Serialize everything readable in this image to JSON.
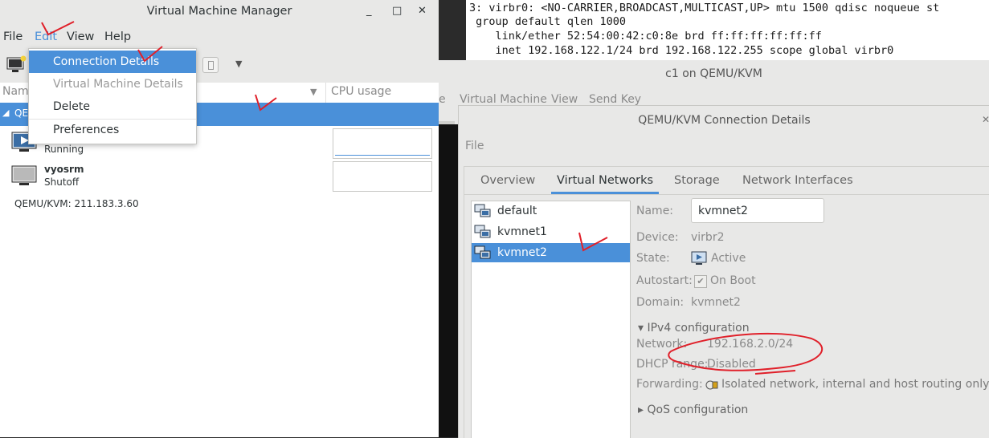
{
  "terminal": {
    "lines": [
      "3: virbr0: <NO-CARRIER,BROADCAST,MULTICAST,UP> mtu 1500 qdisc noqueue st",
      " group default qlen 1000",
      "    link/ether 52:54:00:42:c0:8e brd ff:ff:ff:ff:ff:ff",
      "    inet 192.168.122.1/24 brd 192.168.122.255 scope global virbr0"
    ]
  },
  "c1_window": {
    "title": "c1 on QEMU/KVM",
    "menu": [
      "e",
      "Virtual Machine",
      "View",
      "Send Key"
    ]
  },
  "vmm": {
    "title": "Virtual Machine Manager",
    "minimize": "_",
    "maximize": "□",
    "close": "✕",
    "menu": {
      "file": "File",
      "edit": "Edit",
      "view": "View",
      "help": "Help"
    },
    "columns": {
      "name": "Name",
      "cpu": "CPU usage"
    },
    "group": "QEMU/KVM",
    "vms": [
      {
        "name": "",
        "state": "Running",
        "icon": "vm-running-icon"
      },
      {
        "name": "vyosrm",
        "state": "Shutoff",
        "icon": "vm-shutoff-icon"
      }
    ],
    "connection_label": "QEMU/KVM: 211.183.3.60"
  },
  "edit_menu": {
    "items": [
      {
        "label": "Connection Details",
        "state": "highlighted"
      },
      {
        "label": "Virtual Machine Details",
        "state": "disabled"
      },
      {
        "label": "Delete",
        "state": "normal"
      },
      {
        "label": "Preferences",
        "state": "normal"
      }
    ]
  },
  "connection_details": {
    "title": "QEMU/KVM Connection Details",
    "menu_file": "File",
    "tabs": [
      "Overview",
      "Virtual Networks",
      "Storage",
      "Network Interfaces"
    ],
    "active_tab": "Virtual Networks",
    "networks": [
      "default",
      "kvmnet1",
      "kvmnet2"
    ],
    "selected_network": "kvmnet2",
    "fields": {
      "name_label": "Name:",
      "name_value": "kvmnet2",
      "device_label": "Device:",
      "device_value": "virbr2",
      "state_label": "State:",
      "state_value": "Active",
      "autostart_label": "Autostart:",
      "autostart_value": "On Boot",
      "domain_label": "Domain:",
      "domain_value": "kvmnet2"
    },
    "ipv4": {
      "section": "IPv4 configuration",
      "network_label": "Network:",
      "network_value": "192.168.2.0/24",
      "dhcp_label": "DHCP range:",
      "dhcp_value": "Disabled",
      "forwarding_label": "Forwarding:",
      "forwarding_value": "Isolated network, internal and host routing only"
    },
    "qos_section": "QoS configuration"
  },
  "colors": {
    "selection": "#4a90d9",
    "annotation": "#e0202a",
    "window_bg": "#e8e8e7"
  }
}
